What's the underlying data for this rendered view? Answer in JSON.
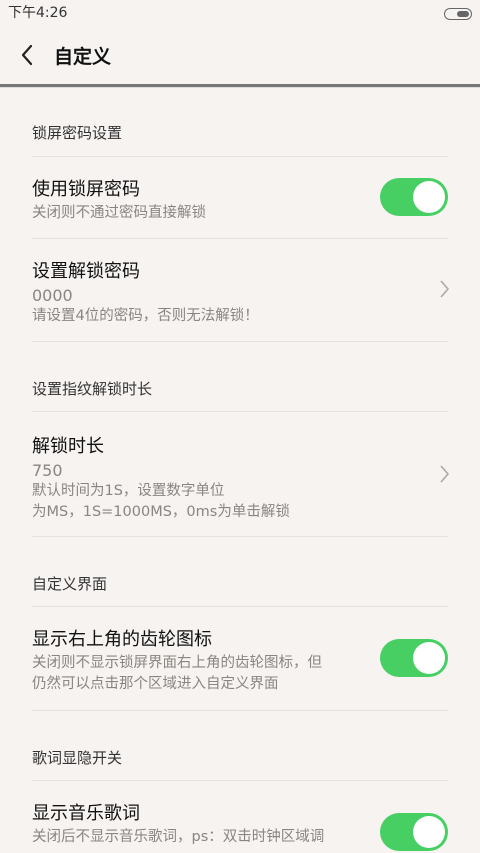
{
  "status_bar": {
    "time": "下午4:26"
  },
  "header": {
    "title": "自定义"
  },
  "sections": {
    "lock": {
      "label": "锁屏密码设置"
    },
    "fingerprint": {
      "label": "设置指纹解锁时长"
    },
    "custom": {
      "label": "自定义界面"
    },
    "lyrics": {
      "label": "歌词显隐开关"
    }
  },
  "rows": {
    "use_lock": {
      "title": "使用锁屏密码",
      "subtitle": "关闭则不通过密码直接解锁",
      "enabled": true
    },
    "set_pwd": {
      "title": "设置解锁密码",
      "value": "0000",
      "subtitle": "请设置4位的密码，否则无法解锁！"
    },
    "unlock_time": {
      "title": "解锁时长",
      "value": "750",
      "subtitle1": "默认时间为1S，设置数字单位",
      "subtitle2": "为MS，1S=1000MS，0ms为单击解锁"
    },
    "gear": {
      "title": "显示右上角的齿轮图标",
      "subtitle1": "关闭则不显示锁屏界面右上角的齿轮图标，但",
      "subtitle2": "仍然可以点击那个区域进入自定义界面",
      "enabled": true
    },
    "lyrics": {
      "title": "显示音乐歌词",
      "subtitle": "关闭后不显示音乐歌词，ps：双击时钟区域调",
      "enabled": true
    }
  },
  "colors": {
    "toggle_on": "#47cf64",
    "background": "#f6f3f1"
  },
  "icons": [
    "back-arrow-icon",
    "chevron-right-icon",
    "battery-icon"
  ]
}
